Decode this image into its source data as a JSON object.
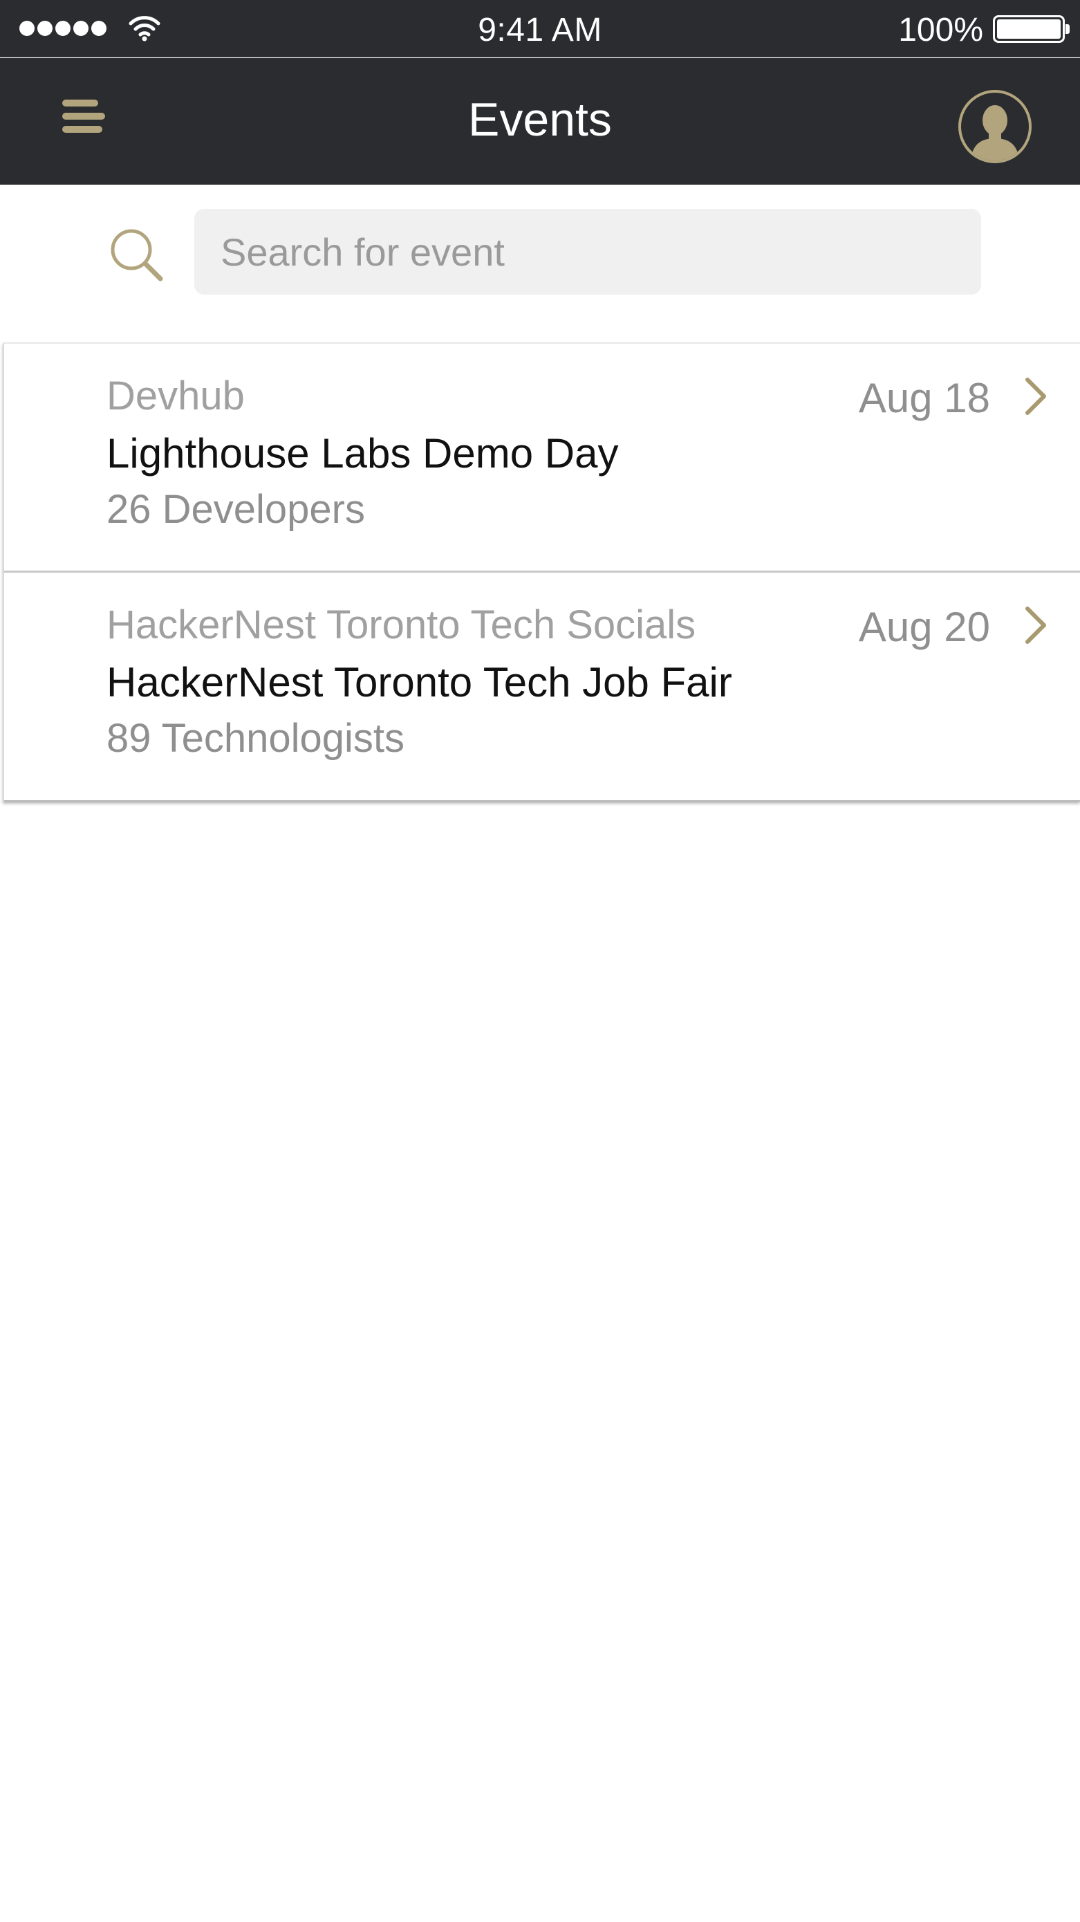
{
  "status_bar": {
    "time": "9:41 AM",
    "battery": "100%"
  },
  "header": {
    "title": "Events"
  },
  "search": {
    "placeholder": "Search for event",
    "value": ""
  },
  "events": [
    {
      "organizer": "Devhub",
      "name": "Lighthouse Labs Demo Day",
      "attendees": "26 Developers",
      "date": "Aug 18"
    },
    {
      "organizer": "HackerNest Toronto Tech Socials",
      "name": "HackerNest Toronto Tech Job Fair",
      "attendees": "89 Technologists",
      "date": "Aug 20"
    }
  ],
  "colors": {
    "nav_background": "#2b2c30",
    "accent_gold": "#b2a57e",
    "search_field": "#f0f0f0"
  },
  "icons": {
    "menu": "menu-icon",
    "profile": "user-avatar-icon",
    "search": "search-icon",
    "row_disclosure": "chevron-right-icon"
  }
}
